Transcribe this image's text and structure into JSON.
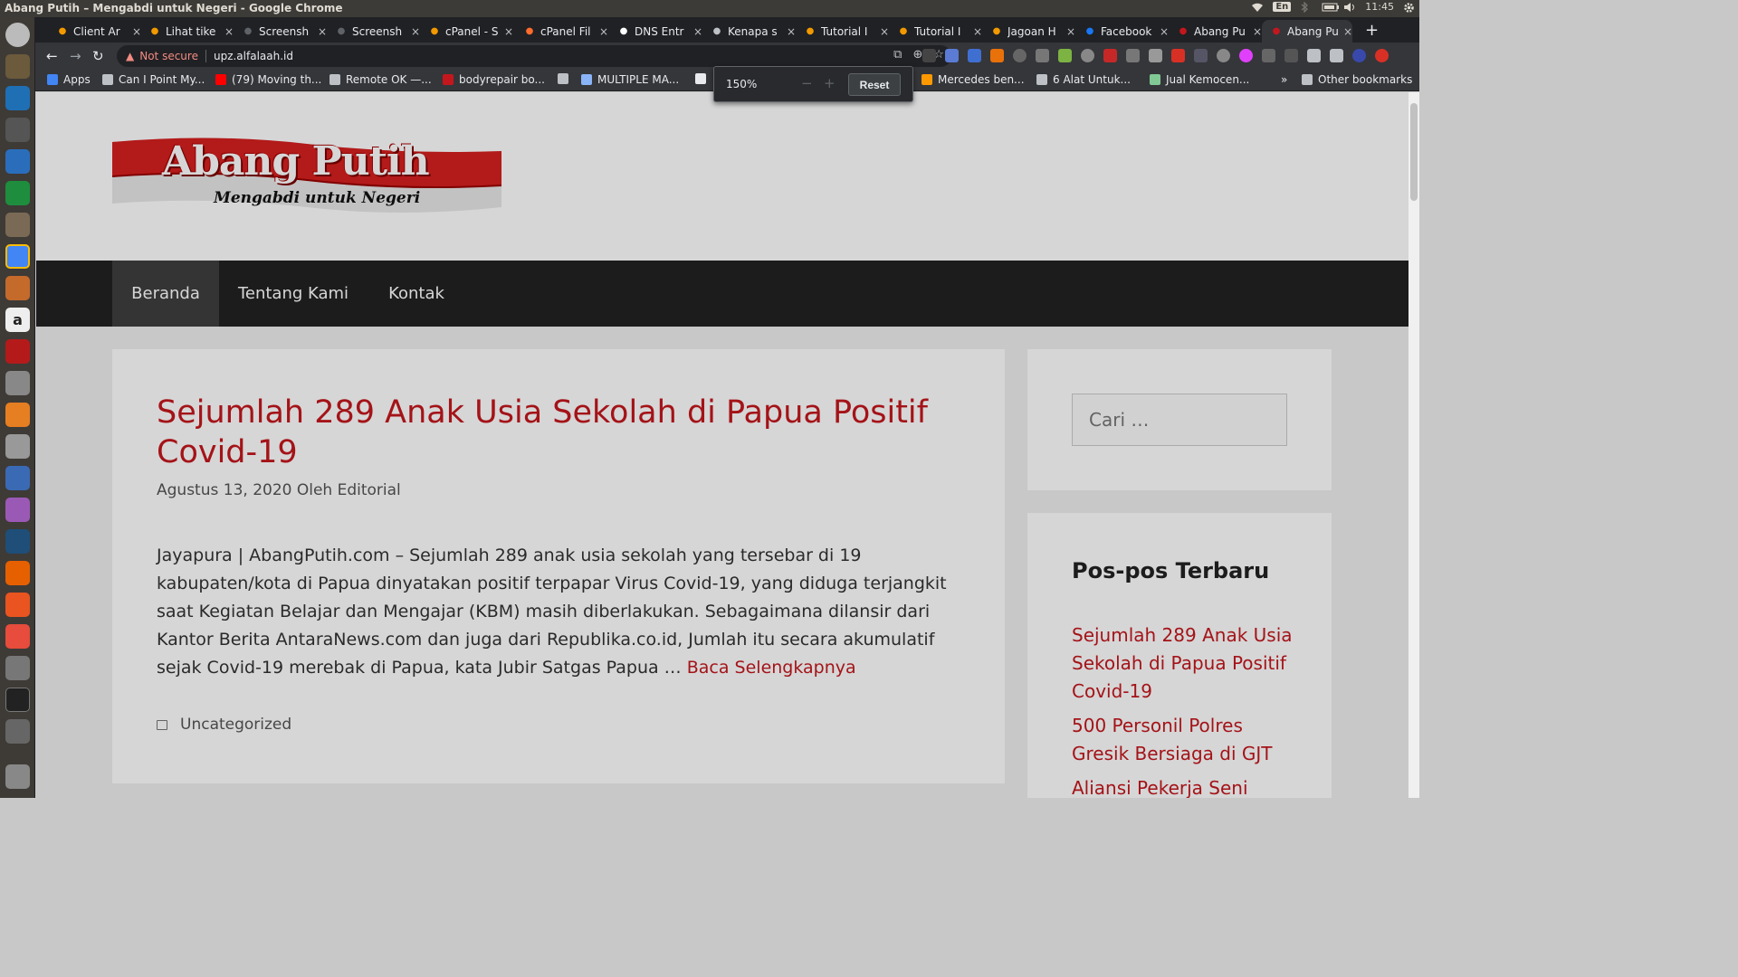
{
  "os": {
    "window_title": "Abang Putih – Mengabdi untuk Negeri - Google Chrome",
    "keyboard_lang": "En",
    "clock": "11:45"
  },
  "tabs": [
    {
      "title": "Client Ar",
      "favicon": "jh-icon",
      "color": "#f29900"
    },
    {
      "title": "Lihat tike",
      "favicon": "jh-icon",
      "color": "#f29900"
    },
    {
      "title": "Screensh",
      "favicon": "screenshot-icon",
      "color": "#5f6368"
    },
    {
      "title": "Screensh",
      "favicon": "screenshot-icon",
      "color": "#5f6368"
    },
    {
      "title": "cPanel - S",
      "favicon": "jh-icon",
      "color": "#f29900"
    },
    {
      "title": "cPanel Fil",
      "favicon": "cpanel-icon",
      "color": "#ff6c2c"
    },
    {
      "title": "DNS Entr",
      "favicon": "h-icon",
      "color": "#ffffff"
    },
    {
      "title": "Kenapa s",
      "favicon": "globe-icon",
      "color": "#bdc1c6"
    },
    {
      "title": "Tutorial I",
      "favicon": "jh-icon",
      "color": "#f29900"
    },
    {
      "title": "Tutorial I",
      "favicon": "jh-icon",
      "color": "#f29900"
    },
    {
      "title": "Jagoan H",
      "favicon": "jh-icon",
      "color": "#f29900"
    },
    {
      "title": "Facebook",
      "favicon": "facebook-icon",
      "color": "#1877f2"
    },
    {
      "title": "Abang Pu",
      "favicon": "abangputih-icon",
      "color": "#c4171d"
    },
    {
      "title": "Abang Pu",
      "favicon": "abangputih-icon",
      "color": "#c4171d",
      "active": true
    }
  ],
  "omnibox": {
    "security": "Not secure",
    "url": "upz.alfalaah.id"
  },
  "bookmarks": [
    {
      "label": "Apps",
      "icon": "apps-icon",
      "color": "#4285f4"
    },
    {
      "label": "Can I Point My...",
      "icon": "bookmark-icon",
      "color": "#bdc1c6"
    },
    {
      "label": "(79) Moving th...",
      "icon": "youtube-icon",
      "color": "#ff0000"
    },
    {
      "label": "Remote OK —...",
      "icon": "remoteok-icon",
      "color": "#bdc1c6"
    },
    {
      "label": "bodyrepair bo...",
      "icon": "bodyrepair-icon",
      "color": "#c4171d"
    },
    {
      "label": "",
      "icon": "globe-icon",
      "color": "#bdc1c6"
    },
    {
      "label": "MULTIPLE MA...",
      "icon": "cloud-icon",
      "color": "#8ab4f8"
    },
    {
      "label": "",
      "icon": "circle-icon",
      "color": "#e8eaed"
    },
    {
      "label": "Mercedes ben...",
      "icon": "olx-icon",
      "color": "#ff9900"
    },
    {
      "label": "6 Alat Untuk...",
      "icon": "doc-icon",
      "color": "#bdc1c6"
    },
    {
      "label": "Jual Kemocen...",
      "icon": "shop-icon",
      "color": "#81c995"
    }
  ],
  "other_bookmarks": "Other bookmarks",
  "zoom": {
    "level": "150%",
    "minus": "−",
    "plus": "+",
    "reset": "Reset"
  },
  "site": {
    "logo_text": "Abang Putih",
    "logo_tagline": "Mengabdi untuk Negeri",
    "nav": [
      "Beranda",
      "Tentang Kami",
      "Kontak"
    ],
    "article": {
      "title": "Sejumlah 289 Anak Usia Sekolah di Papua Positif Covid-19",
      "meta": "Agustus 13, 2020 Oleh Editorial",
      "excerpt": "Jayapura | AbangPutih.com – Sejumlah 289 anak usia sekolah yang tersebar di 19 kabupaten/kota di Papua dinyatakan positif terpapar Virus Covid-19, yang diduga terjangkit saat Kegiatan Belajar dan Mengajar (KBM) masih diberlakukan. Sebagaimana dilansir dari Kantor Berita AntaraNews.com dan juga dari Republika.co.id, Jumlah itu secara akumulatif sejak Covid-19 merebak di Papua, kata Jubir Satgas Papua …",
      "read_more": "Baca Selengkapnya",
      "category": "Uncategorized"
    },
    "search_placeholder": "Cari …",
    "recent_title": "Pos-pos Terbaru",
    "recent_posts": [
      "Sejumlah 289 Anak Usia Sekolah di Papua Positif Covid-19",
      "500 Personil Polres Gresik Bersiaga di GJT",
      "Aliansi Pekerja Seni"
    ]
  },
  "colors": {
    "accent": "#c4171d",
    "nav_bg": "#222222",
    "chrome_dark": "#35363a"
  }
}
